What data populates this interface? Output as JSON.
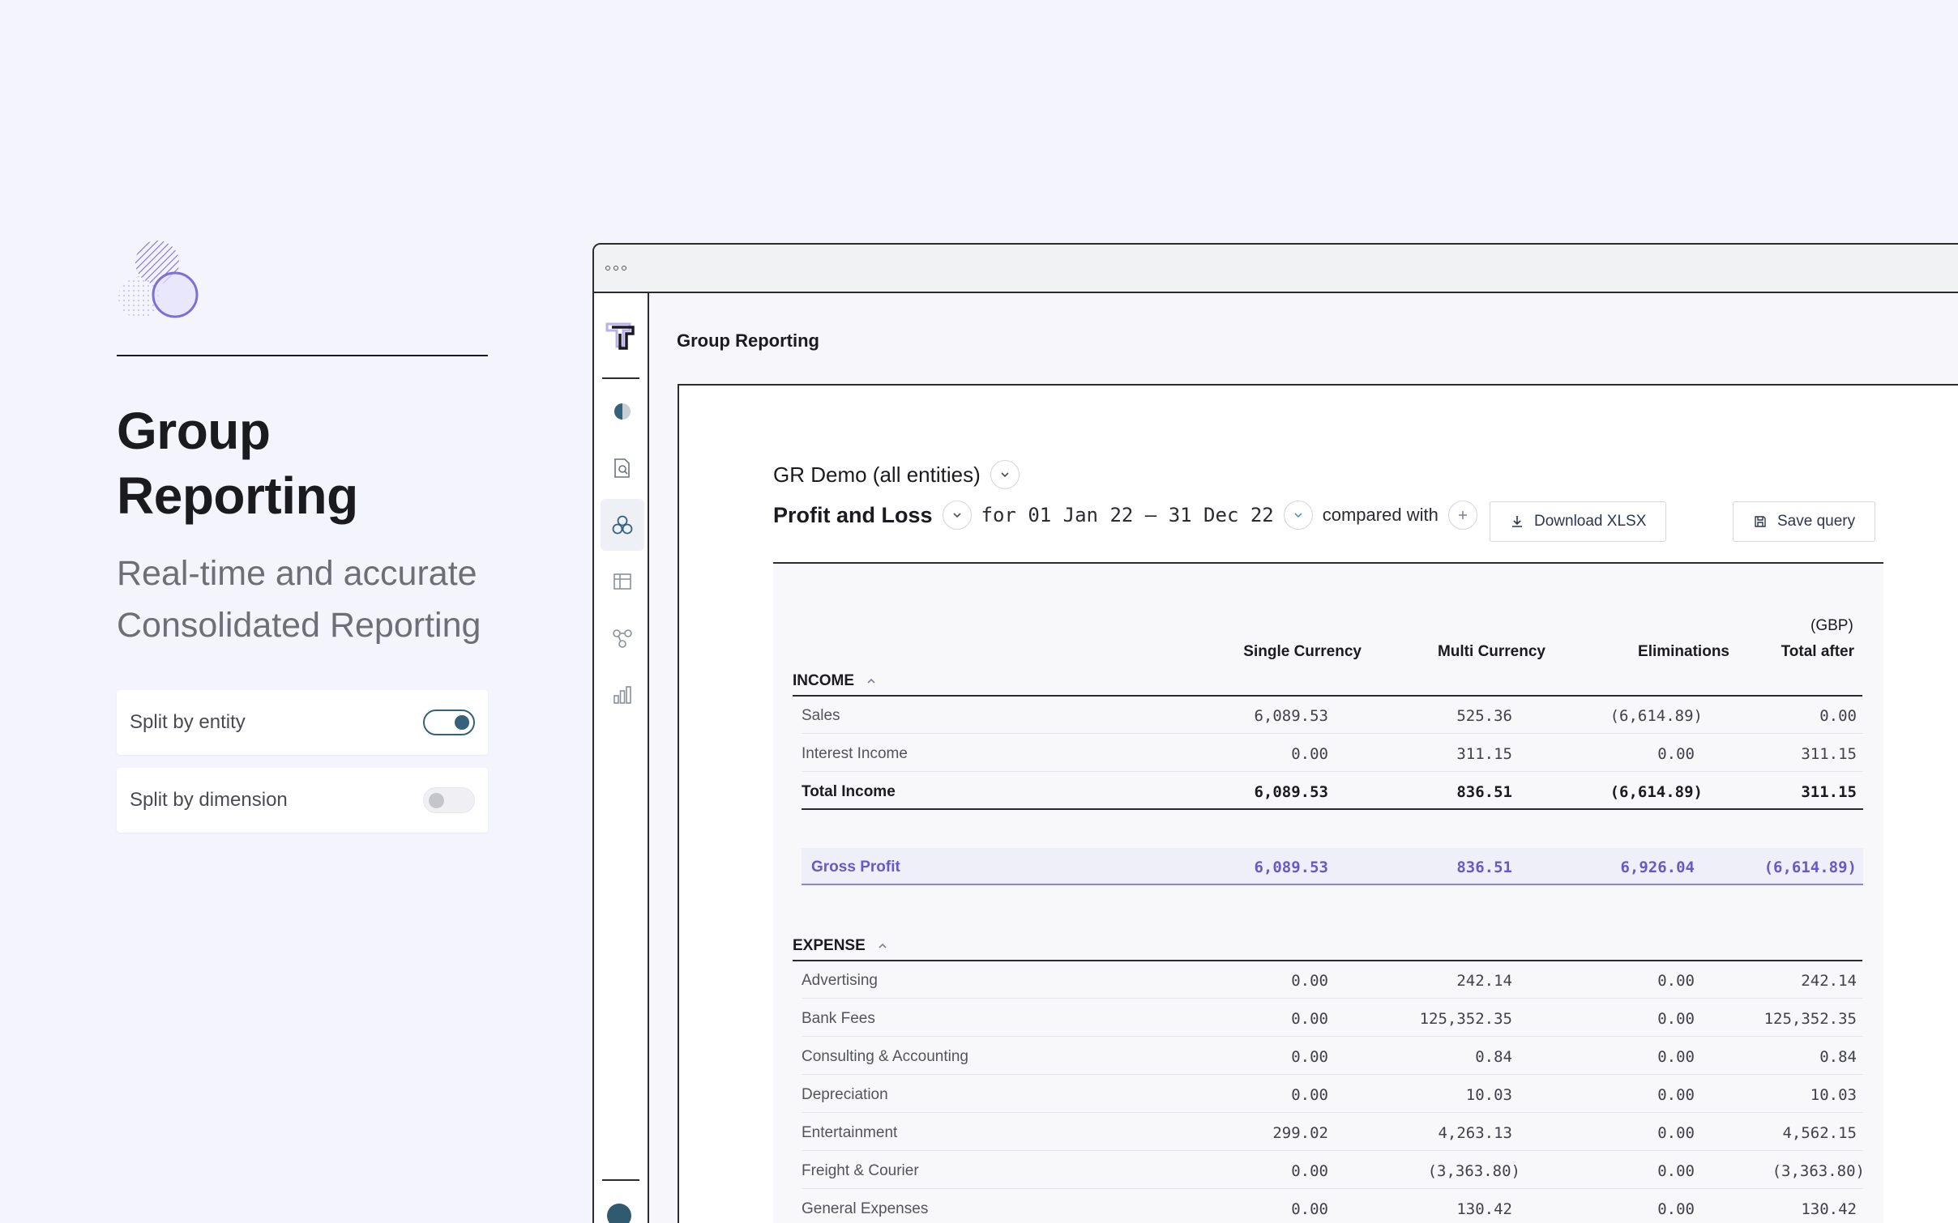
{
  "promo": {
    "title_line1": "Group",
    "title_line2": "Reporting",
    "subtitle_line1": "Real-time and accurate",
    "subtitle_line2": "Consolidated Reporting",
    "toggles": [
      {
        "label": "Split by entity",
        "on": true
      },
      {
        "label": "Split by dimension",
        "on": false
      }
    ]
  },
  "app": {
    "page_title": "Group Reporting",
    "nav_icons": [
      "half-circle-icon",
      "document-search-icon",
      "group-circles-icon",
      "table-icon",
      "nodes-icon",
      "bar-chart-icon"
    ],
    "accent_color": "#6a58c8",
    "avatar_color": "#2f5a70"
  },
  "report": {
    "entity": "GR Demo (all entities)",
    "type": "Profit and Loss",
    "period": "for 01 Jan 22 – 31 Dec 22",
    "compared_label": "compared with",
    "download_label": "Download XLSX",
    "save_label": "Save query",
    "currency": "(GBP)",
    "columns": [
      "Single Currency",
      "Multi Currency",
      "Eliminations",
      "Total after"
    ],
    "income_header": "INCOME",
    "income_rows": [
      {
        "label": "Sales",
        "values": [
          "6,089.53",
          "525.36",
          "(6,614.89)",
          "0.00"
        ]
      },
      {
        "label": "Interest Income",
        "values": [
          "0.00",
          "311.15",
          "0.00",
          "311.15"
        ]
      }
    ],
    "income_total": {
      "label": "Total Income",
      "values": [
        "6,089.53",
        "836.51",
        "(6,614.89)",
        "311.15"
      ]
    },
    "gross_profit": {
      "label": "Gross Profit",
      "values": [
        "6,089.53",
        "836.51",
        "6,926.04",
        "(6,614.89)"
      ]
    },
    "expense_header": "EXPENSE",
    "expense_rows": [
      {
        "label": "Advertising",
        "values": [
          "0.00",
          "242.14",
          "0.00",
          "242.14"
        ]
      },
      {
        "label": "Bank Fees",
        "values": [
          "0.00",
          "125,352.35",
          "0.00",
          "125,352.35"
        ]
      },
      {
        "label": "Consulting & Accounting",
        "values": [
          "0.00",
          "0.84",
          "0.00",
          "0.84"
        ]
      },
      {
        "label": "Depreciation",
        "values": [
          "0.00",
          "10.03",
          "0.00",
          "10.03"
        ]
      },
      {
        "label": "Entertainment",
        "values": [
          "299.02",
          "4,263.13",
          "0.00",
          "4,562.15"
        ]
      },
      {
        "label": "Freight & Courier",
        "values": [
          "0.00",
          "(3,363.80)",
          "0.00",
          "(3,363.80)"
        ]
      },
      {
        "label": "General Expenses",
        "values": [
          "0.00",
          "130.42",
          "0.00",
          "130.42"
        ]
      }
    ]
  }
}
